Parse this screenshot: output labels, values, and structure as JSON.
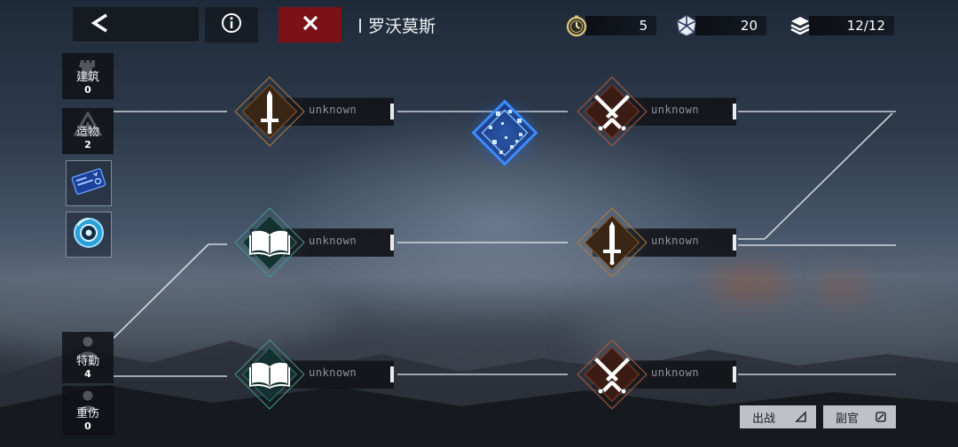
{
  "header": {
    "stage_title": "罗沃莫斯"
  },
  "resources": [
    {
      "name": "timer",
      "icon": "stopwatch-icon",
      "value": "5"
    },
    {
      "name": "crystal",
      "icon": "crystal-icon",
      "value": "20"
    },
    {
      "name": "supplies",
      "icon": "stack-icon",
      "value": "12/12"
    }
  ],
  "sidebar": {
    "building": {
      "label": "建筑",
      "count": "0"
    },
    "artifact": {
      "label": "造物",
      "count": "2"
    },
    "items": [
      {
        "name": "blue-card",
        "icon": "card-item-icon"
      },
      {
        "name": "blue-orb",
        "icon": "orb-item-icon"
      }
    ],
    "agent": {
      "label": "特勤",
      "count": "4"
    },
    "injured": {
      "label": "重伤",
      "count": "0"
    }
  },
  "nodes": [
    {
      "id": "r1c1",
      "type": "sword",
      "icon": "sword-icon",
      "label": "unknown"
    },
    {
      "id": "r1c2",
      "type": "battle",
      "icon": "crossed-swords-icon",
      "label": "unknown"
    },
    {
      "id": "r2c1",
      "type": "book",
      "icon": "book-icon",
      "label": "unknown"
    },
    {
      "id": "r2c2",
      "type": "sword",
      "icon": "sword-icon",
      "label": "unknown"
    },
    {
      "id": "r3c1",
      "type": "book",
      "icon": "book-icon",
      "label": "unknown"
    },
    {
      "id": "r3c2",
      "type": "battle",
      "icon": "crossed-swords-icon",
      "label": "unknown"
    }
  ],
  "bottom": {
    "deploy_label": "出战",
    "adjutant_label": "副官"
  },
  "colors": {
    "close_red": "#7a1218",
    "player_blue": "#3a8cff",
    "sword_bronze": "#b57a3d",
    "battle_rust": "#b55a3a",
    "book_teal": "#3f9a92"
  }
}
